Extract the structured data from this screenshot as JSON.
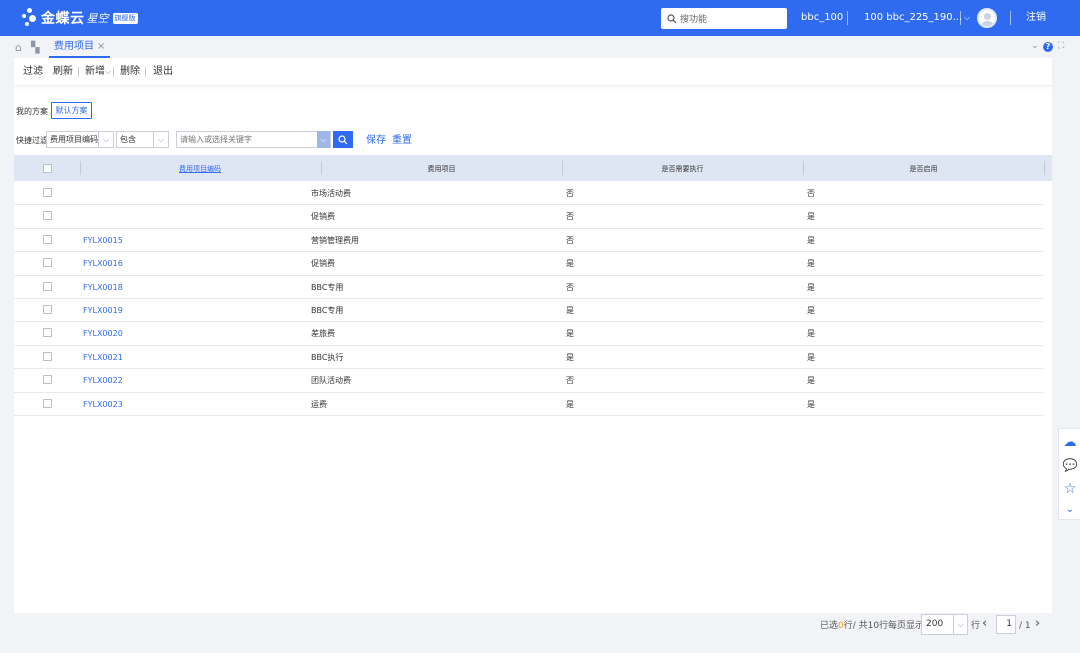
{
  "topbar": {
    "brand": "金蝶云",
    "brand_sub": "星空",
    "brand_badge": "旗舰版",
    "search_placeholder": "搜功能",
    "org": "bbc_100",
    "account": "100 bbc_225_190...",
    "logout": "注销"
  },
  "tabs": {
    "active": "费用项目",
    "close": "×"
  },
  "toolbar": {
    "filter": "过滤",
    "refresh": "刷新",
    "new": "新增",
    "delete": "删除",
    "exit": "退出"
  },
  "scheme": {
    "label": "我的方案",
    "default_button": "默认方案"
  },
  "quick_filter": {
    "label": "快捷过滤",
    "field": "费用项目编码",
    "operator": "包含",
    "keyword_placeholder": "请输入或选择关键字",
    "save": "保存",
    "reset": "重置"
  },
  "table": {
    "columns": [
      "费用项目编码",
      "费用项目",
      "是否需要执行",
      "是否启用"
    ],
    "rows": [
      {
        "code": "",
        "name": "市场活动费",
        "need_exec": "否",
        "enabled": "否"
      },
      {
        "code": "",
        "name": "促销费",
        "need_exec": "否",
        "enabled": "是"
      },
      {
        "code": "FYLX0015",
        "name": "营销管理费用",
        "need_exec": "否",
        "enabled": "是"
      },
      {
        "code": "FYLX0016",
        "name": "促销费",
        "need_exec": "是",
        "enabled": "是"
      },
      {
        "code": "FYLX0018",
        "name": "BBC专用",
        "need_exec": "否",
        "enabled": "是"
      },
      {
        "code": "FYLX0019",
        "name": "BBC专用",
        "need_exec": "是",
        "enabled": "是"
      },
      {
        "code": "FYLX0020",
        "name": "差旅费",
        "need_exec": "是",
        "enabled": "是"
      },
      {
        "code": "FYLX0021",
        "name": "BBC执行",
        "need_exec": "是",
        "enabled": "是"
      },
      {
        "code": "FYLX0022",
        "name": "团队活动费",
        "need_exec": "否",
        "enabled": "是"
      },
      {
        "code": "FYLX0023",
        "name": "运费",
        "need_exec": "是",
        "enabled": "是"
      }
    ]
  },
  "footer": {
    "selected_prefix": "已选",
    "selected_count": "0",
    "selected_suffix": "行/ 共10行",
    "per_page_label": "每页显示",
    "per_page": "200",
    "rows_unit": "行",
    "page_current": "1",
    "page_total": "/ 1"
  },
  "colors": {
    "primary": "#2f6bf0",
    "header_bg": "#dfe6f3",
    "selected_count": "#f39c12"
  }
}
